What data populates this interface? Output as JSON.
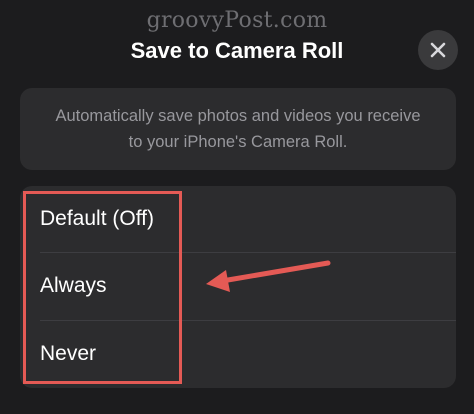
{
  "watermark": "groovyPost.com",
  "sheet": {
    "title": "Save to Camera Roll",
    "close_icon": "close-icon"
  },
  "info": {
    "text_line1": "Automatically save photos and videos you receive",
    "text_line2": "to your iPhone's Camera Roll."
  },
  "options": [
    {
      "label": "Default (Off)"
    },
    {
      "label": "Always"
    },
    {
      "label": "Never"
    }
  ],
  "annotation": {
    "highlight_color": "#e45a55",
    "arrow_color": "#e45a55",
    "arrow_icon": "arrow-left-icon"
  },
  "colors": {
    "background": "#1c1c1e",
    "card": "#2c2c2e",
    "secondary_text": "#98989d"
  }
}
